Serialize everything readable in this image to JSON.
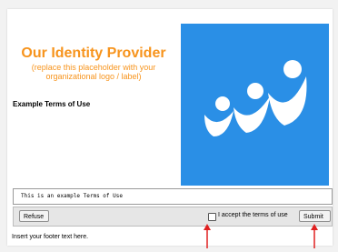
{
  "header": {
    "title": "Our Identity Provider",
    "subtitle_line1": "(replace this placeholder with your",
    "subtitle_line2": "organizational logo / label)"
  },
  "logo": {
    "icon": "logo-icon",
    "background_color": "#2a8fe6"
  },
  "terms": {
    "heading": "Example Terms of Use",
    "body": "This is an example Terms of Use"
  },
  "actions": {
    "refuse_label": "Refuse",
    "accept_label": "I accept the terms of use",
    "accept_checked": false,
    "submit_label": "Submit"
  },
  "footer": {
    "text": "Insert your footer text here."
  },
  "annotations": {
    "arrow_color": "#e02020"
  },
  "colors": {
    "title": "#f7941d",
    "logo_bg": "#2a8fe6"
  }
}
